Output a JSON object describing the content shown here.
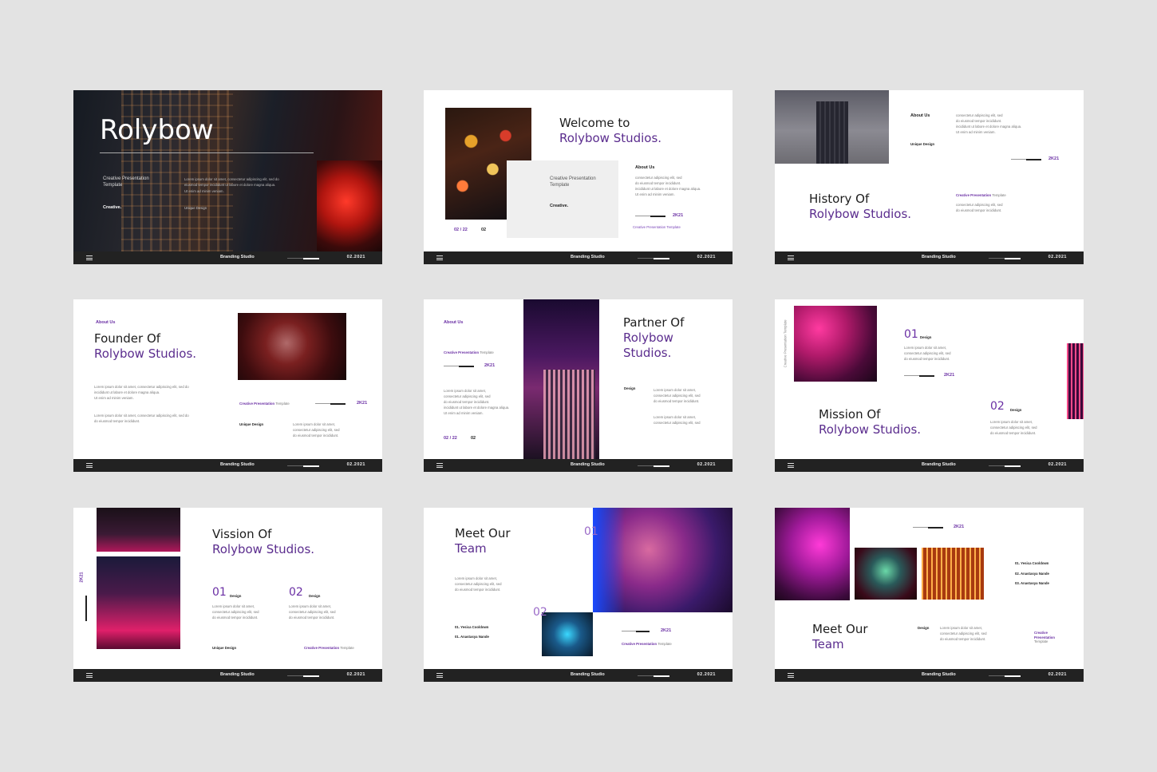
{
  "footer": {
    "menu": "≡",
    "studio": "Branding Studio",
    "date": "02.2021"
  },
  "lorem": {
    "l1": "Lorem ipsum dolor sit amet,",
    "l2": "consectetur adipiscing elit, sed",
    "l3": "do eiusmod tempor incididunt.",
    "l4": "Ut enim ad minim veniam.",
    "l5": "incididunt ut labore et dolore magna aliqua."
  },
  "s1": {
    "title": "Rolybow",
    "sub1": "Creative Presentation",
    "sub2": "Template",
    "tag": "Creative.",
    "body1": "Lorem ipsum dolor sit amet, consectetur adipiscing elit, sed do",
    "body2": "eiusmod tempor incididunt ut labore et dolore magna aliqua.",
    "body3": "Ut enim ad minim veniam.",
    "ud": "Unique Design"
  },
  "s2": {
    "l1": "Welcome to",
    "l2": "Rolybow Studios.",
    "cpt1": "Creative Presentation",
    "cpt2": "Template",
    "creative": "Creative.",
    "about": "About Us",
    "pg": "02 / 22",
    "pg2": "02",
    "k": "2K21",
    "cpt": "Creative Presentation Template"
  },
  "s3": {
    "about": "About Us",
    "ud": "Unique Design",
    "l1": "History Of",
    "l2": "Rolybow Studios.",
    "k": "2K21",
    "cpt": "Creative Presentation",
    "tpl": "Template"
  },
  "s4": {
    "about": "About Us",
    "l1": "Founder Of",
    "l2": "Rolybow Studios.",
    "cpt": "Creative Presentation",
    "tpl": "Template",
    "k": "2K21",
    "ud": "Unique Design"
  },
  "s5": {
    "about": "About Us",
    "cpt": "Creative Presentation",
    "tpl": "Template",
    "k": "2K21",
    "pg": "02 / 22",
    "pg2": "02",
    "l1": "Partner Of",
    "l2": "Rolybow",
    "l3": "Studios.",
    "design": "Design"
  },
  "s6": {
    "side": "Creative Presentation Template",
    "n1": "01",
    "n2": "02",
    "design": "Design",
    "k": "2K21",
    "l1": "Mission Of",
    "l2": "Rolybow Studios."
  },
  "s7": {
    "side": "2K21",
    "l1": "Vission Of",
    "l2": "Rolybow Studios.",
    "n1": "01",
    "n2": "02",
    "design": "Design",
    "ud": "Unique Design",
    "cpt": "Creative Presentation",
    "tpl": "Template"
  },
  "s8": {
    "l1": "Meet Our",
    "l2": "Team",
    "n1": "01",
    "n2": "02",
    "p1": "01. Yesica Cooldown",
    "p2": "01. Anastasya Nande",
    "k": "2K21",
    "cpt": "Creative Presentation",
    "tpl": "Template"
  },
  "s9": {
    "k": "2K21",
    "p1": "01. Yesica Cooldown",
    "p2": "02. Anastasya Nande",
    "p3": "03. Anastasya Nande",
    "l1": "Meet Our",
    "l2": "Team",
    "design": "Design",
    "c1": "Creative",
    "c2": "Presentation",
    "c3": "Template"
  }
}
